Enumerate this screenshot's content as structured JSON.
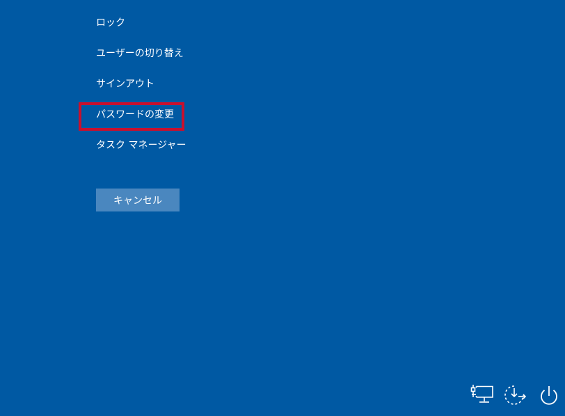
{
  "menu": {
    "items": [
      {
        "label": "ロック"
      },
      {
        "label": "ユーザーの切り替え"
      },
      {
        "label": "サインアウト"
      },
      {
        "label": "パスワードの変更"
      },
      {
        "label": "タスク マネージャー"
      }
    ]
  },
  "cancel_button": {
    "label": "キャンセル"
  },
  "tray": {
    "icons": [
      "network-icon",
      "ease-of-access-icon",
      "power-icon"
    ]
  },
  "colors": {
    "background": "#0059a3",
    "button": "#4a87bf",
    "highlight": "#c8102e",
    "text": "#ffffff"
  }
}
